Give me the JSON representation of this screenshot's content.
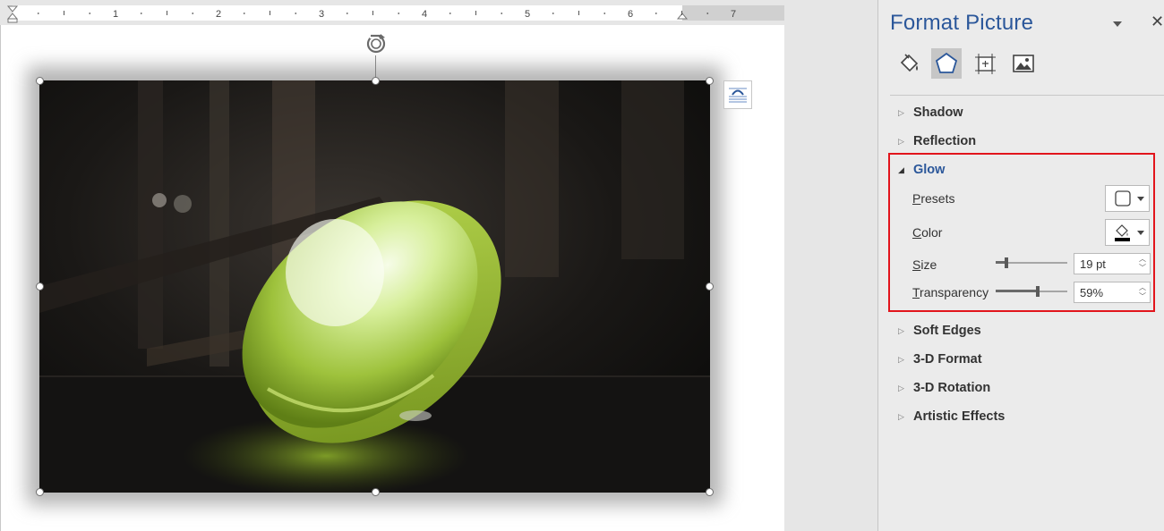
{
  "ruler": {
    "labels": [
      "1",
      "2",
      "3",
      "4",
      "5",
      "6",
      "7"
    ]
  },
  "pane": {
    "title": "Format Picture",
    "tabs": [
      {
        "name": "fill-line",
        "icon": "paint-bucket-icon",
        "active": false
      },
      {
        "name": "effects",
        "icon": "pentagon-icon",
        "active": true
      },
      {
        "name": "size-properties",
        "icon": "size-position-icon",
        "active": false
      },
      {
        "name": "picture",
        "icon": "image-icon",
        "active": false
      }
    ],
    "sections": {
      "shadow": "Shadow",
      "reflection": "Reflection",
      "glow": "Glow",
      "soft_edges": "Soft Edges",
      "format_3d": "3-D Format",
      "rotation_3d": "3-D Rotation",
      "artistic_effects": "Artistic Effects"
    },
    "glow": {
      "presets_label": "Presets",
      "presets_key": "P",
      "presets_rest": "resets",
      "color_label": "Color",
      "color_key": "C",
      "color_rest": "olor",
      "size_key": "S",
      "size_rest": "ize",
      "size_value": "19 pt",
      "size_fraction": 0.15,
      "transparency_key": "T",
      "transparency_rest": "ransparency",
      "transparency_value": "59%",
      "transparency_fraction": 0.59
    }
  },
  "colors": {
    "accent": "#2b579a",
    "highlight_box": "#e2151c",
    "glow_fill": "#000000"
  }
}
